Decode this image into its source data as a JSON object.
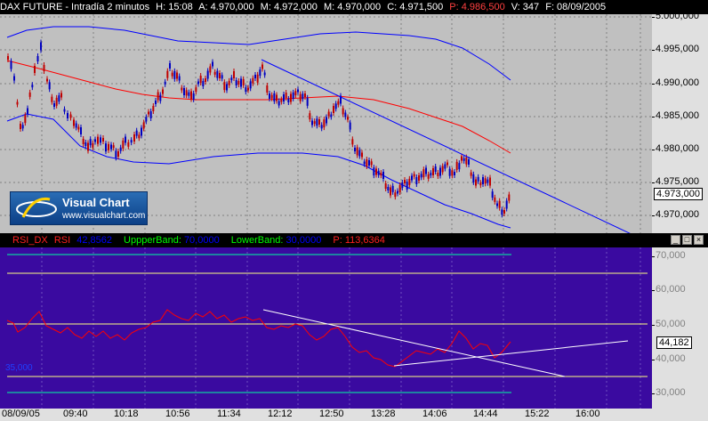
{
  "price_panel": {
    "title": "DAX FUTURE - Intradía 2 minutos",
    "h": "H: 15:08",
    "a": "A: 4.970,000",
    "m": "M: 4.972,000",
    "mn": "M: 4.970,000",
    "c": "C: 4.971,500",
    "p": "P: 4.986,500",
    "v": "V: 347",
    "f": "F: 08/09/2005",
    "y_labels": [
      "5.000,000",
      "4.995,000",
      "4.990,000",
      "4.985,000",
      "4.980,000",
      "4.975,000",
      "4.970,000"
    ],
    "current_value": "4.973,000",
    "colors": {
      "background": "#c0c0c0",
      "candles_up": "#0000c0",
      "candles_down": "#c00000",
      "moving_average": "#ff0000",
      "bands": "#0000ff",
      "trendline": "#0000ff"
    }
  },
  "logo": {
    "name": "Visual Chart",
    "url": "www.visualchart.com"
  },
  "rsi_panel": {
    "name": "RSI_DX",
    "rsi_label": "RSI",
    "rsi_value": "42,8562",
    "upper_label": "UppperBand:",
    "upper_value": "70,0000",
    "lower_label": "LowerBand:",
    "lower_value": "30,0000",
    "p_label": "P: 113,6364",
    "y_labels": [
      "70,000",
      "60,000",
      "50,000",
      "40,000",
      "30,000"
    ],
    "left_value": "35,000",
    "current_value": "44,182",
    "colors": {
      "background": "#3a0aa0",
      "rsi_line": "#ff0000",
      "level_lines": "#ffff80",
      "band_lines": "#00ffa0",
      "trendline": "#ffffff"
    }
  },
  "x_axis": {
    "labels": [
      "08/09/05",
      "09:40",
      "10:18",
      "10:56",
      "11:34",
      "12:12",
      "12:50",
      "13:28",
      "14:06",
      "14:44",
      "15:22",
      "16:00"
    ]
  },
  "controls": {
    "minimize": "_",
    "maximize": "□",
    "close": "×"
  }
}
